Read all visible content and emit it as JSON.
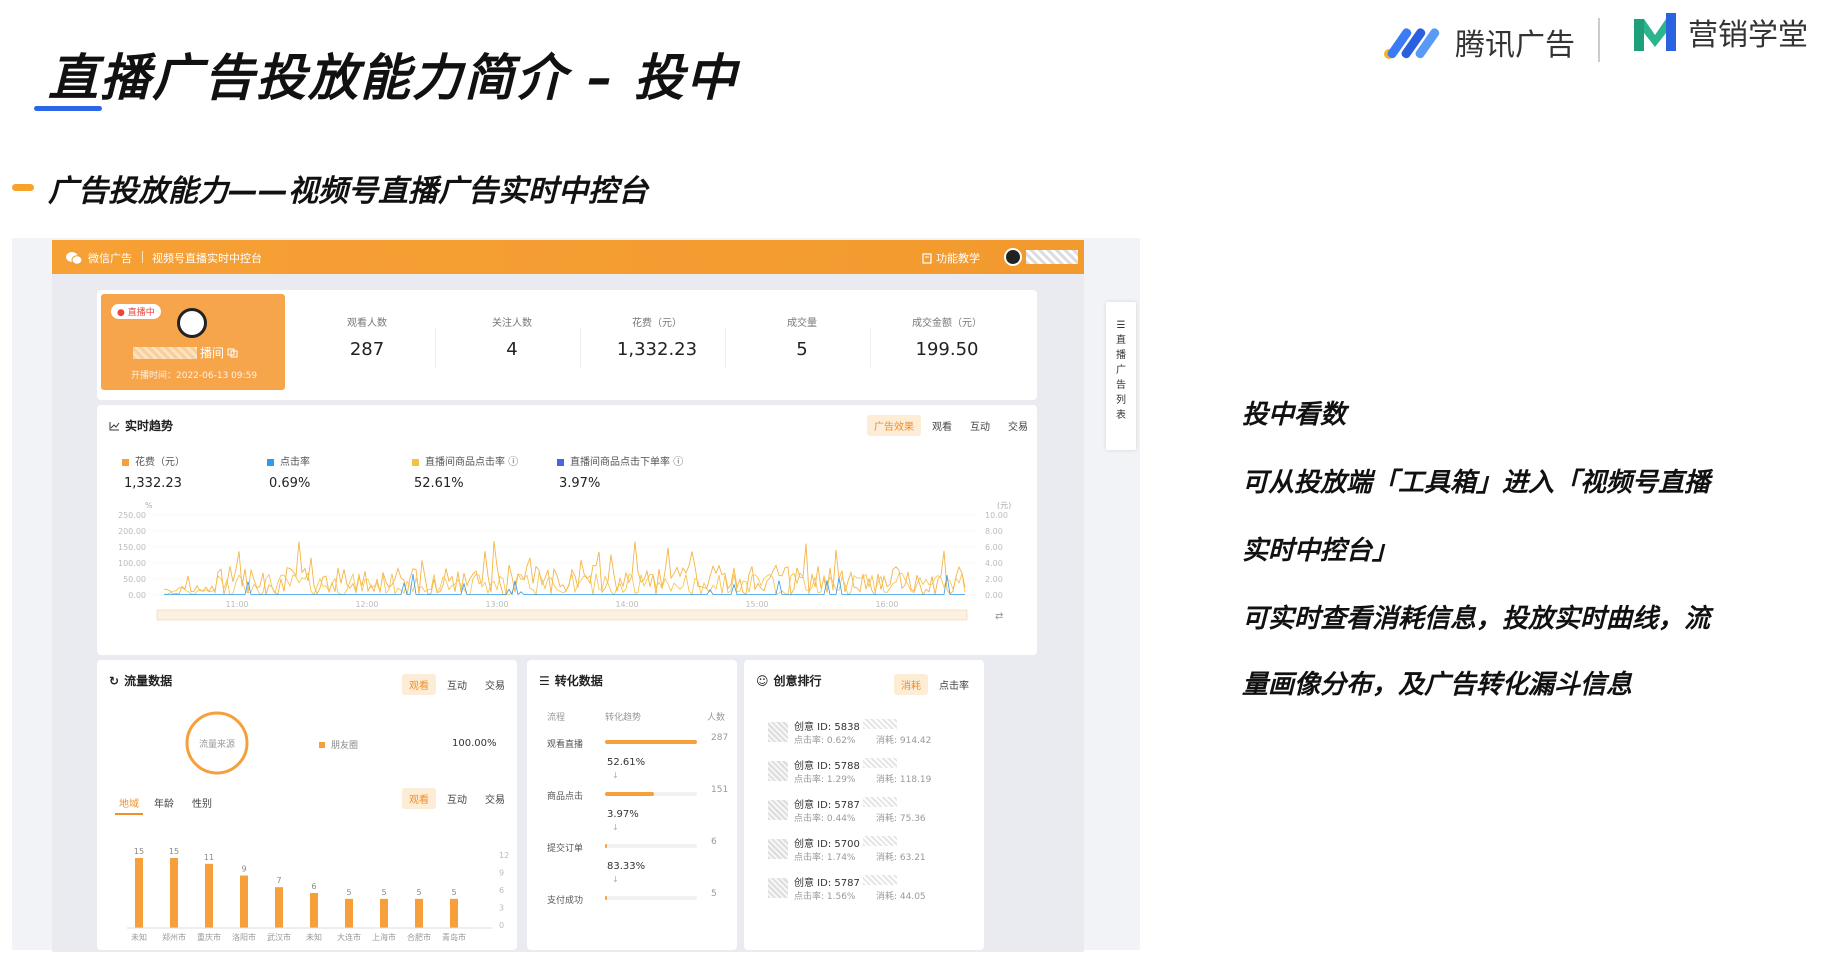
{
  "slide": {
    "title": "直播广告投放能力简介 – 投中",
    "subtitle": "广告投放能力——视频号直播广告实时中控台",
    "logos": {
      "tencent_ads": "腾讯广告",
      "marketing_school": "营销学堂"
    }
  },
  "console": {
    "topbar": {
      "brand": "微信广告",
      "page": "视频号直播实时中控台",
      "help": "功能教学"
    },
    "live": {
      "badge": "直播中",
      "name_suffix": "播间",
      "start_time": "开播时间：2022-06-13 09:59"
    },
    "stats": [
      {
        "label": "观看人数",
        "value": "287"
      },
      {
        "label": "关注人数",
        "value": "4"
      },
      {
        "label": "花费（元）",
        "value": "1,332.23"
      },
      {
        "label": "成交量",
        "value": "5"
      },
      {
        "label": "成交金额（元）",
        "value": "199.50"
      }
    ],
    "trend": {
      "title": "实时趋势",
      "tabs": [
        "广告效果",
        "观看",
        "互动",
        "交易"
      ],
      "legend": [
        {
          "label": "花费（元）",
          "value": "1,332.23",
          "color": "#f5a03a"
        },
        {
          "label": "点击率",
          "value": "0.69%",
          "color": "#2d9bf0"
        },
        {
          "label": "直播间商品点击率",
          "value": "52.61%",
          "color": "#f4c245"
        },
        {
          "label": "直播间商品点击下单率",
          "value": "3.97%",
          "color": "#4b64e0"
        }
      ],
      "y_left_unit": "%",
      "y_right_unit": "(元)",
      "y_left_ticks": [
        "250.00",
        "200.00",
        "150.00",
        "100.00",
        "50.00",
        "0.00"
      ],
      "y_right_ticks": [
        "10.00",
        "8.00",
        "6.00",
        "4.00",
        "2.00",
        "0.00"
      ],
      "x_ticks": [
        "11:00",
        "12:00",
        "13:00",
        "14:00",
        "15:00",
        "16:00"
      ]
    },
    "traffic": {
      "title": "流量数据",
      "tabs": [
        "观看",
        "互动",
        "交易"
      ],
      "donut_label": "流量来源",
      "source_name": "朋友圈",
      "source_value": "100.00%",
      "subtabs": [
        "地域",
        "年龄",
        "性别"
      ],
      "subtabs2": [
        "观看",
        "互动",
        "交易"
      ],
      "y_ticks": [
        "12",
        "9",
        "6",
        "3",
        "0"
      ]
    },
    "conversion": {
      "title": "转化数据",
      "headers": [
        "流程",
        "转化趋势",
        "人数"
      ],
      "steps": [
        {
          "name": "观看直播",
          "count": "287",
          "fill": 1.0
        },
        {
          "name": "商品点击",
          "count": "151",
          "fill": 0.53
        },
        {
          "name": "提交订单",
          "count": "6",
          "fill": 0.02
        },
        {
          "name": "支付成功",
          "count": "5",
          "fill": 0.02
        }
      ],
      "rates": [
        "52.61%",
        "3.97%",
        "83.33%"
      ]
    },
    "creative": {
      "title": "创意排行",
      "tabs": [
        "消耗",
        "点击率"
      ],
      "items": [
        {
          "id": "创意 ID: 5838",
          "ctr": "点击率: 0.62%",
          "cost": "消耗: 914.42"
        },
        {
          "id": "创意 ID: 5788",
          "ctr": "点击率: 1.29%",
          "cost": "消耗: 118.19"
        },
        {
          "id": "创意 ID: 5787",
          "ctr": "点击率: 0.44%",
          "cost": "消耗: 75.36"
        },
        {
          "id": "创意 ID: 5700",
          "ctr": "点击率: 1.74%",
          "cost": "消耗: 63.21"
        },
        {
          "id": "创意 ID: 5787",
          "ctr": "点击率: 1.56%",
          "cost": "消耗: 44.05"
        }
      ]
    },
    "side_tab": [
      "直",
      "播",
      "广",
      "告",
      "列",
      "表"
    ]
  },
  "chart_data": {
    "type": "bar",
    "categories": [
      "未知",
      "郑州市",
      "重庆市",
      "洛阳市",
      "武汉市",
      "未知",
      "大连市",
      "上海市",
      "合肥市",
      "青岛市"
    ],
    "values": [
      15,
      15,
      11,
      9,
      7,
      6,
      5,
      5,
      5,
      5
    ],
    "ylim": [
      0,
      12
    ]
  },
  "right_text": {
    "heading": "投中看数",
    "lines": [
      "可从投放端「工具箱」进入「视频号直播",
      "实时中控台」",
      "可实时查看消耗信息，投放实时曲线，流",
      "量画像分布，及广告转化漏斗信息"
    ]
  },
  "colors": {
    "orange": "#f5a03a",
    "blue": "#2c67e8",
    "light_orange": "#fdecd6"
  }
}
